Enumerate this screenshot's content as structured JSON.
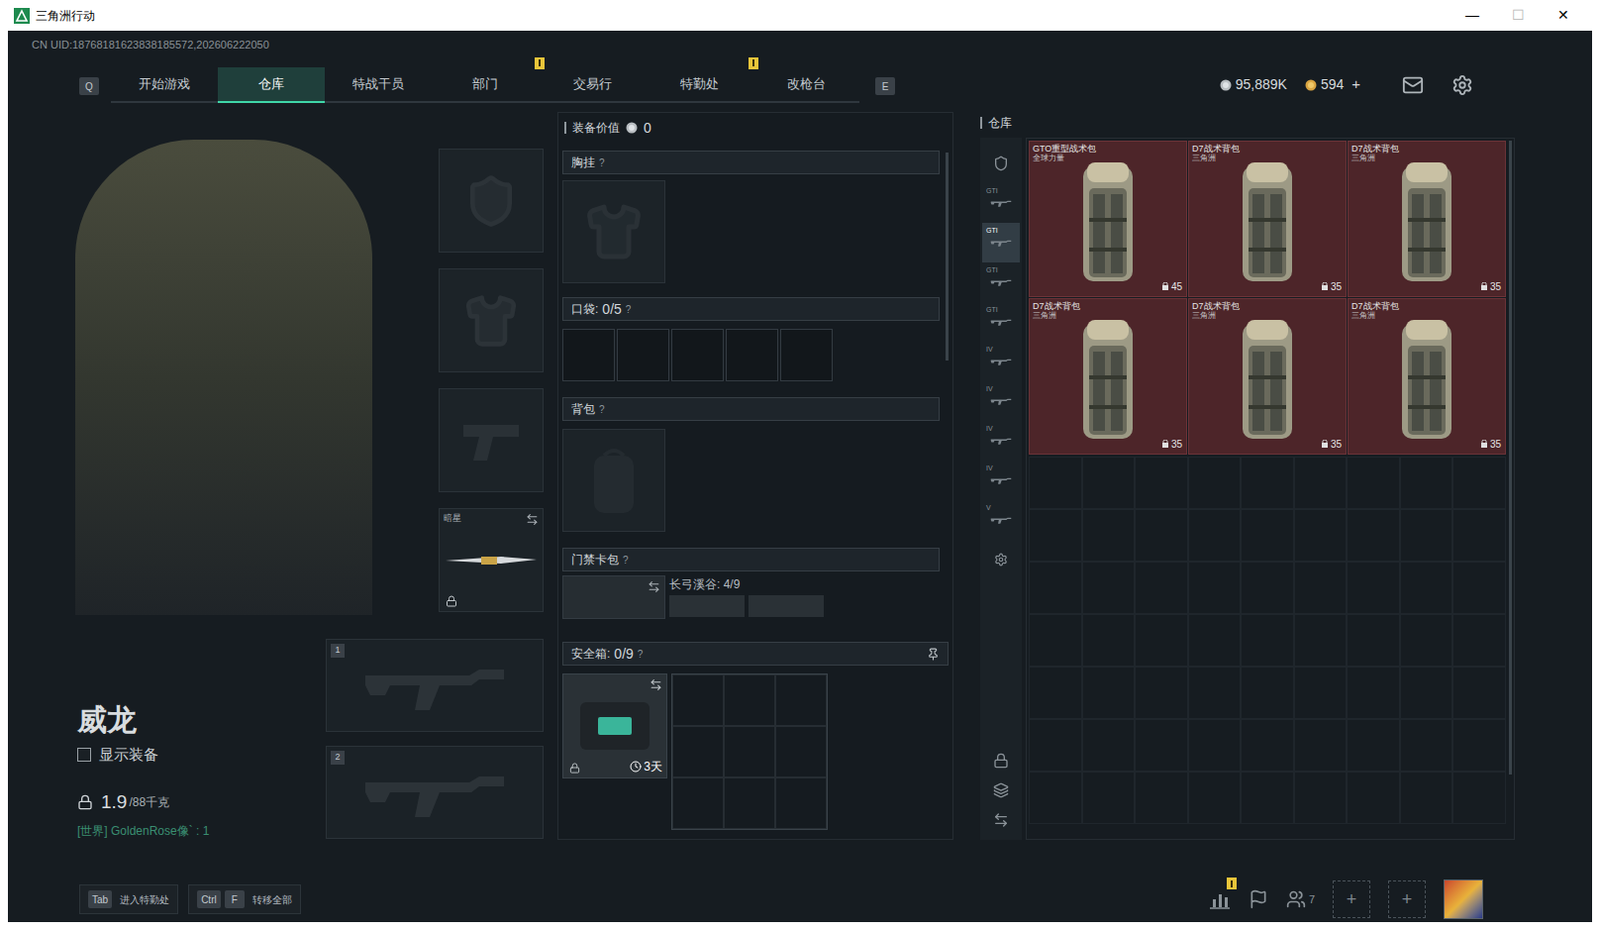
{
  "window": {
    "title": "三角洲行动",
    "controls": [
      "—",
      "☐",
      "✕"
    ]
  },
  "uid": "CN UID:18768181623838185572,202606222050",
  "nav": {
    "prev_key": "Q",
    "next_key": "E",
    "tabs": [
      {
        "label": "开始游戏",
        "selected": false,
        "badge": false
      },
      {
        "label": "仓库",
        "selected": true,
        "badge": false
      },
      {
        "label": "特战干员",
        "selected": false,
        "badge": false
      },
      {
        "label": "部门",
        "selected": false,
        "badge": true
      },
      {
        "label": "交易行",
        "selected": false,
        "badge": false
      },
      {
        "label": "特勤处",
        "selected": false,
        "badge": true
      },
      {
        "label": "改枪台",
        "selected": false,
        "badge": false
      }
    ]
  },
  "currencies": [
    {
      "kind": "silver",
      "amount": "95,889K",
      "add": ""
    },
    {
      "kind": "gold",
      "amount": "594",
      "add": "+"
    }
  ],
  "character": {
    "name": "威龙",
    "show_equipment": {
      "label": "显示装备",
      "checked": false
    },
    "weight": "1.9",
    "weight_max": "/88千克",
    "chat": "[世界] GoldenRose像` : 1"
  },
  "equipment_slots": [
    {
      "kind": "helmet",
      "label": "",
      "locked": false
    },
    {
      "kind": "armor",
      "label": "",
      "locked": false
    },
    {
      "kind": "pistol",
      "label": "",
      "locked": false
    },
    {
      "kind": "melee",
      "label": "暗星",
      "locked": true
    }
  ],
  "gun_slots": [
    {
      "number": "1"
    },
    {
      "number": "2"
    }
  ],
  "loadout": {
    "value_label": "装备价值",
    "value": "0",
    "chest_rig": {
      "label": "胸挂",
      "help": "?"
    },
    "pockets": {
      "label": "口袋:",
      "count": "0/5",
      "help": "?",
      "slots": 5
    },
    "backpack": {
      "label": "背包",
      "help": "?"
    },
    "keycard": {
      "label": "门禁卡包",
      "help": "?",
      "map": "长弓溪谷: 4/9"
    },
    "safe_box": {
      "label": "安全箱:",
      "count": "0/9",
      "help": "?",
      "timer": "3天",
      "locked": true
    }
  },
  "warehouse": {
    "title": "仓库",
    "tabs": [
      {
        "kind": "helmet",
        "label": "",
        "selected": false
      },
      {
        "kind": "gun",
        "label": "GTI",
        "selected": false
      },
      {
        "kind": "gun",
        "label": "GTI",
        "selected": true
      },
      {
        "kind": "gun",
        "label": "GTI",
        "selected": false
      },
      {
        "kind": "gun",
        "label": "GTI",
        "selected": false
      },
      {
        "kind": "gun",
        "label": "IV",
        "selected": false
      },
      {
        "kind": "gun",
        "label": "IV",
        "selected": false
      },
      {
        "kind": "gun",
        "label": "IV",
        "selected": false
      },
      {
        "kind": "gun",
        "label": "IV",
        "selected": false
      },
      {
        "kind": "gun",
        "label": "V",
        "selected": false
      },
      {
        "kind": "gear",
        "label": "",
        "selected": false
      }
    ],
    "items": [
      {
        "name": "GTO重型战术包",
        "source": "全球力量",
        "count": "45"
      },
      {
        "name": "D7战术背包",
        "source": "三角洲",
        "count": "35"
      },
      {
        "name": "D7战术背包",
        "source": "三角洲",
        "count": "35"
      },
      {
        "name": "D7战术背包",
        "source": "三角洲",
        "count": "35"
      },
      {
        "name": "D7战术背包",
        "source": "三角洲",
        "count": "35"
      },
      {
        "name": "D7战术背包",
        "source": "三角洲",
        "count": "35"
      }
    ]
  },
  "bottom_bar": {
    "hints": [
      {
        "keys": [
          "Tab"
        ],
        "label": "进入特勤处"
      },
      {
        "keys": [
          "Ctrl",
          "F"
        ],
        "label": "转移全部"
      }
    ],
    "stats_badge": true,
    "friends_count": "7",
    "add_slots": [
      "+",
      "+"
    ]
  }
}
